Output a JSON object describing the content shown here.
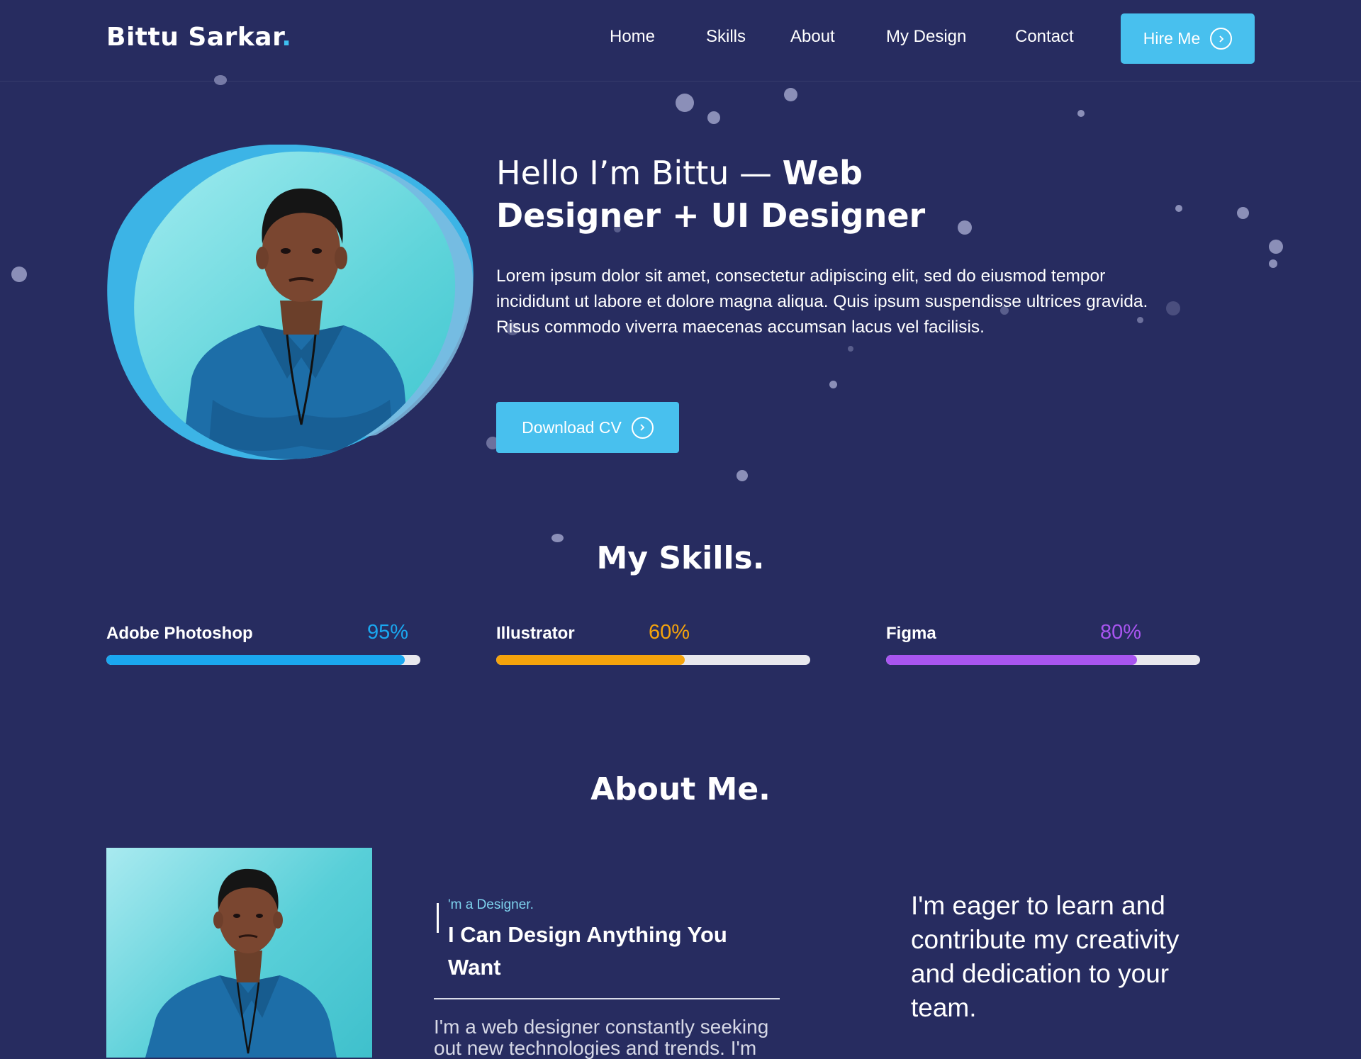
{
  "header": {
    "logo": "Bittu Sarkar",
    "logo_dot": ".",
    "nav": [
      "Home",
      "Skills",
      "About",
      "My Design",
      "Contact"
    ],
    "hire_label": "Hire Me"
  },
  "hero": {
    "title_light": "Hello I’m Bittu — ",
    "title_bold_1": "Web",
    "title_bold_2": "Designer + UI Designer",
    "text": "Lorem ipsum dolor sit amet, consectetur adipiscing elit, sed do eiusmod tempor incididunt ut labore et dolore magna aliqua. Quis ipsum suspendisse ultrices gravida. Risus commodo viverra maecenas accumsan lacus vel facilisis.",
    "cv_label": "Download CV"
  },
  "skills": {
    "title": "My Skills.",
    "items": [
      {
        "name": "Adobe Photoshop",
        "percent_label": "95%",
        "value": 95,
        "color": "#1aa7f0"
      },
      {
        "name": "Illustrator",
        "percent_label": "60%",
        "value": 60,
        "color": "#f5a30c"
      },
      {
        "name": "Figma",
        "percent_label": "80%",
        "value": 80,
        "color": "#a855f0"
      }
    ]
  },
  "about": {
    "title": "About Me.",
    "subtitle": "'m a Designer.",
    "heading": "I Can Design Anything You Want",
    "text": "I'm a web designer constantly seeking out new technologies and trends. I'm",
    "quote": "I'm eager to learn and contribute my creativity and dedication to your team."
  },
  "colors": {
    "background": "#272c60",
    "accent": "#48c0ee"
  }
}
